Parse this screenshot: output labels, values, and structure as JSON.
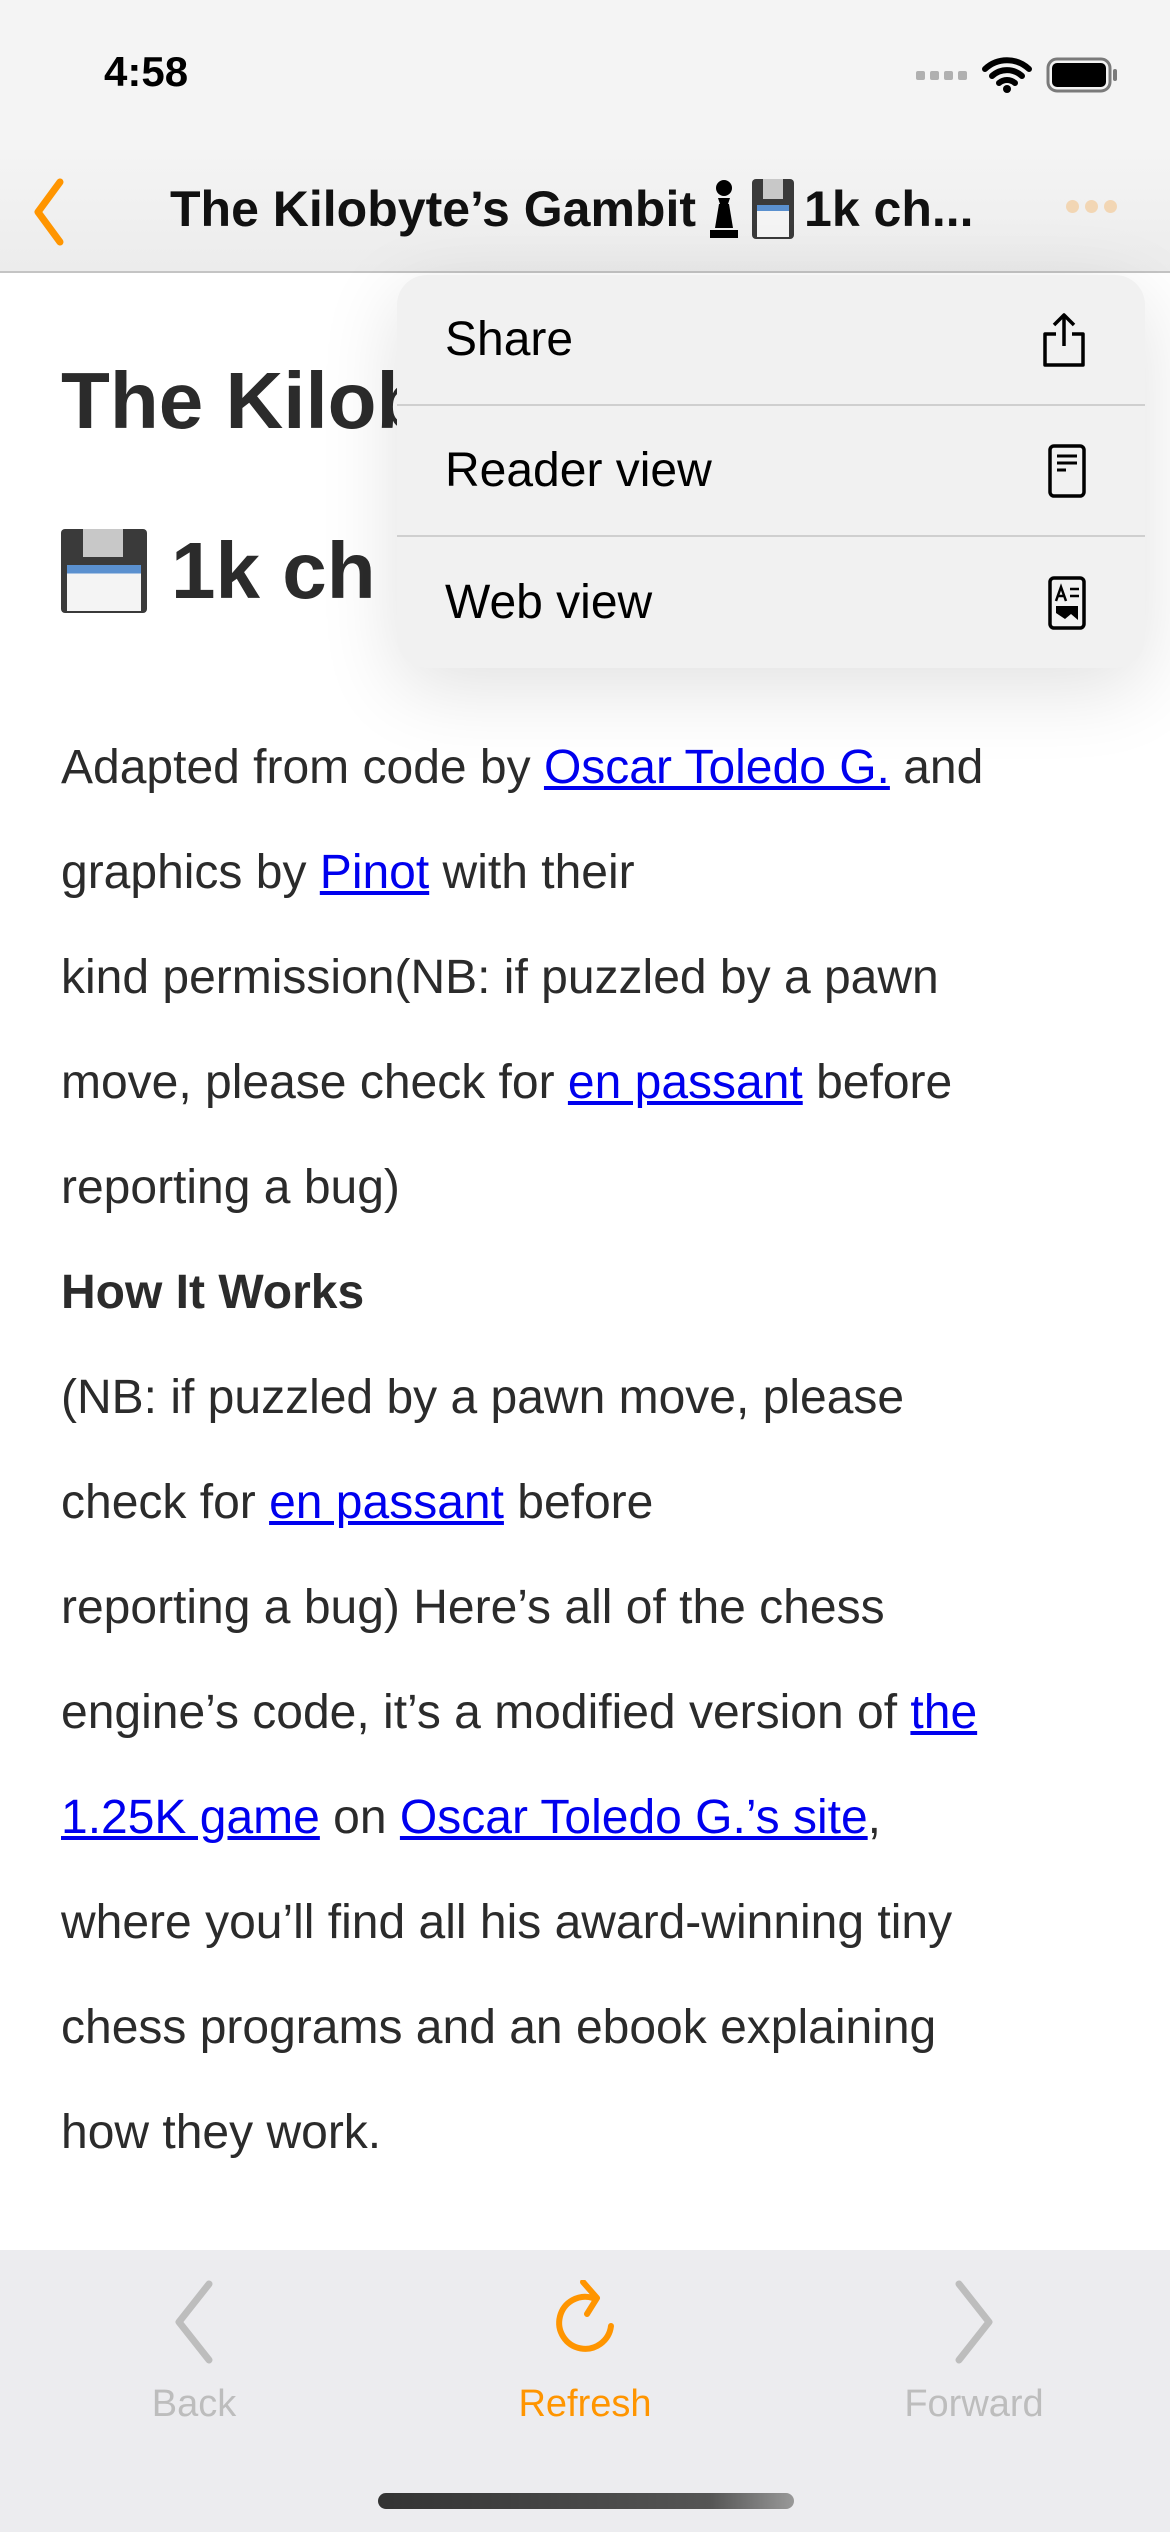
{
  "status": {
    "time": "4:58"
  },
  "nav": {
    "title": "The Kilobyte’s Gambit",
    "title_suffix": "1k ch...",
    "accent": "#ff9500"
  },
  "heading": {
    "line1": "The Kilobyte’s Gambit",
    "line2": "1k ch"
  },
  "menu": {
    "items": [
      {
        "label": "Share",
        "icon": "share-icon"
      },
      {
        "label": "Reader view",
        "icon": "reader-view-icon"
      },
      {
        "label": "Web view",
        "icon": "web-view-icon"
      }
    ]
  },
  "body": {
    "lines": [
      [
        {
          "t": "Adapted from code by "
        },
        {
          "t": "Oscar Toledo G.",
          "link": true
        },
        {
          "t": " and"
        }
      ],
      [
        {
          "t": "graphics by "
        },
        {
          "t": "Pinot",
          "link": true
        },
        {
          "t": " with their"
        }
      ],
      [
        {
          "t": "kind permission(NB: if puzzled by a pawn"
        }
      ],
      [
        {
          "t": "move, please check for "
        },
        {
          "t": "en passant",
          "link": true
        },
        {
          "t": " before"
        }
      ],
      [
        {
          "t": "reporting a bug)"
        }
      ],
      [
        {
          "t": "How It Works",
          "bold": true
        }
      ],
      [
        {
          "t": "(NB: if puzzled by a pawn move, please"
        }
      ],
      [
        {
          "t": "check for "
        },
        {
          "t": "en passant",
          "link": true
        },
        {
          "t": " before"
        }
      ],
      [
        {
          "t": "reporting a bug) Here’s all of the chess"
        }
      ],
      [
        {
          "t": "engine’s code, it’s a modified version of "
        },
        {
          "t": "the",
          "link": true
        }
      ],
      [
        {
          "t": "1.25K game",
          "link": true
        },
        {
          "t": " on "
        },
        {
          "t": "Oscar Toledo G.’s site",
          "link": true
        },
        {
          "t": ","
        }
      ],
      [
        {
          "t": "where you’ll find all his award-winning tiny"
        }
      ],
      [
        {
          "t": "chess programs and an ebook explaining"
        }
      ],
      [
        {
          "t": "how they work."
        }
      ]
    ]
  },
  "toolbar": {
    "back": "Back",
    "refresh": "Refresh",
    "forward": "Forward",
    "disabled_color": "#bdbdbd"
  }
}
